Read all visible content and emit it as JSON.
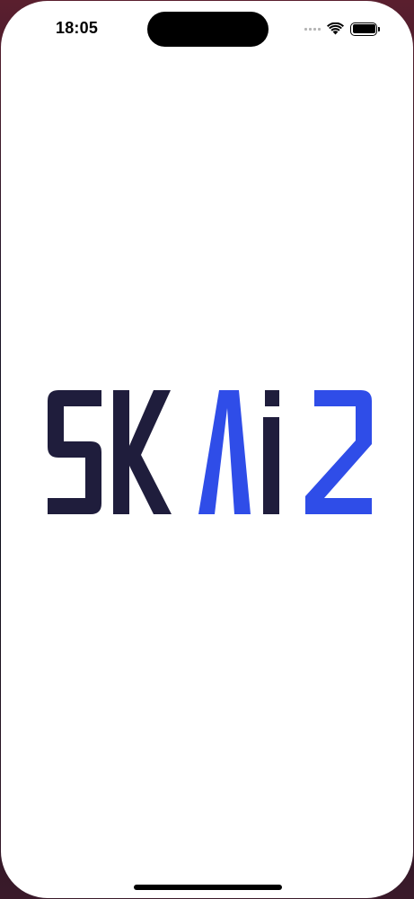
{
  "status_bar": {
    "time": "18:05",
    "icons": [
      "cellular-signal-icon",
      "wifi-icon",
      "battery-icon"
    ]
  },
  "splash": {
    "logo_text": "SKAi2",
    "colors": {
      "dark": "#1f1d3c",
      "blue": "#2f4de8"
    }
  }
}
